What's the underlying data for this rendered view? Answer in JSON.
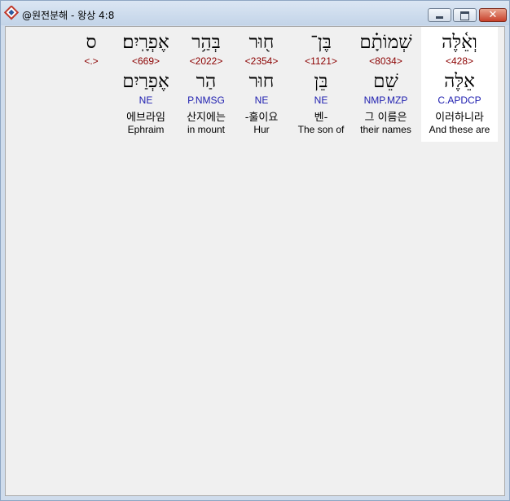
{
  "window": {
    "title": "@원전분해 - 왕상 4:8",
    "close_glyph": "✕"
  },
  "words": [
    {
      "hebrew": "וְאֵ֫לֶּה",
      "strong": "<428>",
      "lemma": "אֵלֶּה",
      "parse": "C.APDCP",
      "korean": "이러하니라",
      "english": "And these are",
      "selected": true
    },
    {
      "hebrew": "שְׁמוֹתָ֗ם",
      "strong": "<8034>",
      "lemma": "שֵׁם",
      "parse": "NMP.MZP",
      "korean": "그 이름은",
      "english": "their names",
      "selected": false
    },
    {
      "hebrew": "בֶּן־",
      "strong": "<1121>",
      "lemma": "בֵּן",
      "parse": "NE",
      "korean": "벤-",
      "english": "The son of",
      "selected": false
    },
    {
      "hebrew": "ח֖וּר",
      "strong": "<2354>",
      "lemma": "חוּר",
      "parse": "NE",
      "korean": "-훌이요",
      "english": "Hur",
      "selected": false
    },
    {
      "hebrew": "בְּהַ֥ר",
      "strong": "<2022>",
      "lemma": "הַר",
      "parse": "P.NMSG",
      "korean": "산지에는",
      "english": "in mount",
      "selected": false
    },
    {
      "hebrew": "אֶפְרָֽיִם׃",
      "strong": "<669>",
      "lemma": "אֶפְרַיִם",
      "parse": "NE",
      "korean": "에브라임",
      "english": "Ephraim",
      "selected": false
    },
    {
      "hebrew": "ס",
      "strong": "<.>",
      "lemma": "",
      "parse": "",
      "korean": "",
      "english": "",
      "selected": false
    }
  ]
}
